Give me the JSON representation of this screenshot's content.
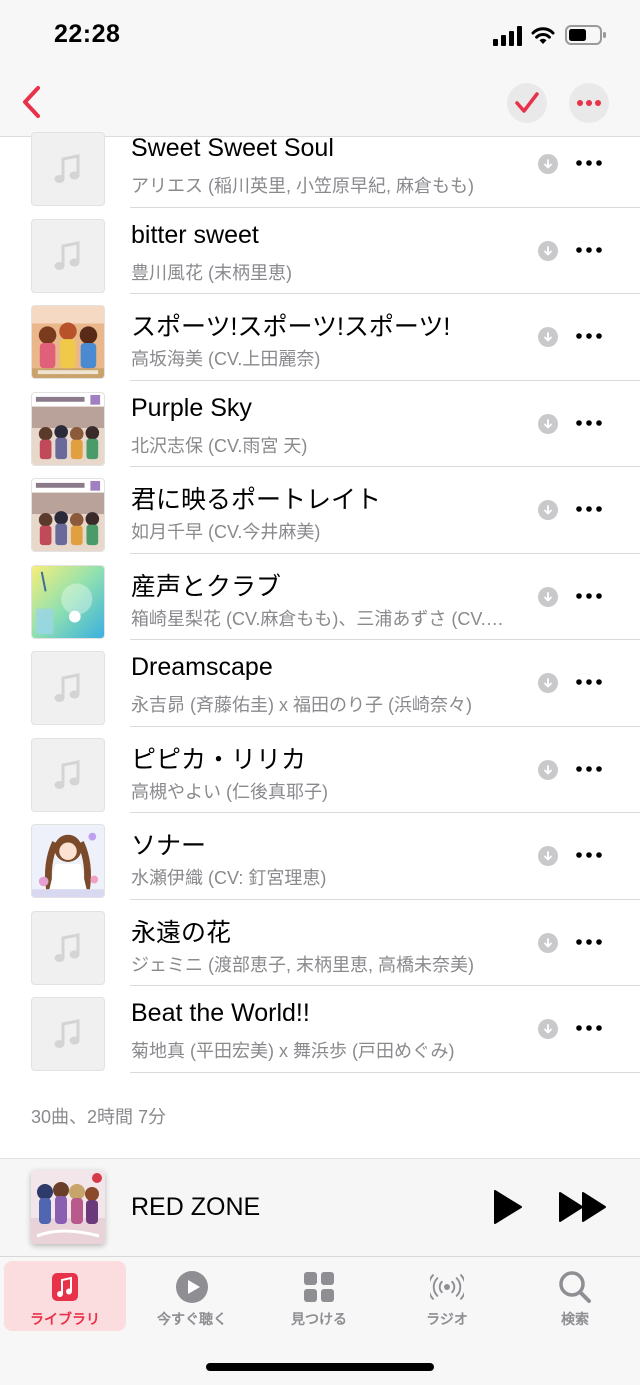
{
  "status_bar": {
    "time": "22:28"
  },
  "accent_color": "#e8324a",
  "songs": [
    {
      "title": "Sweet Sweet Soul",
      "artist": "アリエス (稲川英里, 小笠原早紀, 麻倉もも)",
      "artwork": "placeholder"
    },
    {
      "title": "bitter sweet",
      "artist": "豊川風花 (末柄里恵)",
      "artwork": "placeholder"
    },
    {
      "title": "スポーツ!スポーツ!スポーツ!",
      "artist": "高坂海美 (CV.上田麗奈)",
      "artwork": "cover-ms4"
    },
    {
      "title": "Purple Sky",
      "artist": "北沢志保 (CV.雨宮 天)",
      "artwork": "cover-ms2"
    },
    {
      "title": "君に映るポートレイト",
      "artist": "如月千早 (CV.今井麻美)",
      "artwork": "cover-ms2"
    },
    {
      "title": "産声とクラブ",
      "artist": "箱崎星梨花 (CV.麻倉もも)、三浦あずさ (CV.…",
      "artwork": "cover-pastel"
    },
    {
      "title": "Dreamscape",
      "artist": "永吉昴 (斉藤佑圭) x 福田のり子 (浜崎奈々)",
      "artwork": "placeholder"
    },
    {
      "title": "ピピカ・リリカ",
      "artist": "高槻やよい (仁後真耶子)",
      "artwork": "placeholder"
    },
    {
      "title": "ソナー",
      "artist": "水瀬伊織 (CV: 釘宮理恵)",
      "artwork": "cover-iori"
    },
    {
      "title": "永遠の花",
      "artist": "ジェミニ (渡部恵子, 末柄里恵, 高橋未奈美)",
      "artwork": "placeholder"
    },
    {
      "title": "Beat the World!!",
      "artist": "菊地真 (平田宏美) x 舞浜歩 (戸田めぐみ)",
      "artwork": "placeholder"
    }
  ],
  "footer": {
    "count": "30曲、2時間 7分"
  },
  "now_playing": {
    "title": "RED ZONE"
  },
  "tabs": [
    {
      "label": "ライブラリ",
      "icon": "music-note-icon",
      "active": true
    },
    {
      "label": "今すぐ聴く",
      "icon": "play-circle-icon",
      "active": false
    },
    {
      "label": "見つける",
      "icon": "grid-icon",
      "active": false
    },
    {
      "label": "ラジオ",
      "icon": "radio-icon",
      "active": false
    },
    {
      "label": "検索",
      "icon": "search-icon",
      "active": false
    }
  ]
}
